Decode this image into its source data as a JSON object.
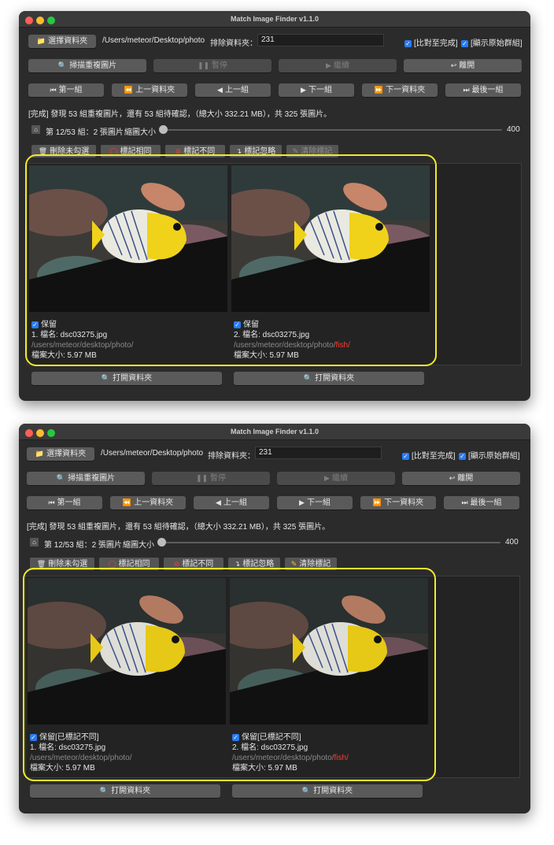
{
  "app": {
    "title": "Match Image Finder v1.1.0"
  },
  "toolbar": {
    "choose_folder": "選擇資料夾",
    "folder_path": "/Users/meteor/Desktop/photo",
    "exclude_label": "排除資料夾：",
    "exclude_value": "231",
    "compare_done": "[比對至完成]",
    "show_original": "[顯示原始群組]"
  },
  "actions": {
    "scan": "掃描重複圖片",
    "pause": "暫停",
    "resume": "繼續",
    "leave": "離開"
  },
  "nav": {
    "first": "第一組",
    "prev_folder": "上一資料夾",
    "prev": "上一組",
    "next": "下一組",
    "next_folder": "下一資料夾",
    "last": "最後一組"
  },
  "status": "[完成] 發現 53 組重複圖片，還有 53 組待確認，（總大小 332.21 MB），共 325 張圖片。",
  "group": {
    "info": "第 12/53 組：2 張圖片",
    "zoom_label": "縮圖大小",
    "zoom_value": "400",
    "zoom_fraction": 0.0
  },
  "marks": {
    "delete_unchecked": "刪除未勾選",
    "mark_same": "標記相同",
    "mark_diff": "標記不同",
    "mark_ignore": "標記忽略",
    "clear_marks": "清除標記"
  },
  "screens": [
    {
      "cards": [
        {
          "keep": "保留",
          "name": "1. 檔名: dsc03275.jpg",
          "path": "/users/meteor/desktop/photo/",
          "path_extra": "",
          "size": "檔案大小: 5.97 MB"
        },
        {
          "keep": "保留",
          "name": "2. 檔名: dsc03275.jpg",
          "path": "/users/meteor/desktop/photo/",
          "path_extra": "fish/",
          "size": "檔案大小: 5.97 MB"
        }
      ],
      "open_folder": "打開資料夾"
    },
    {
      "cards": [
        {
          "keep": "保留[已標記不同]",
          "name": "1. 檔名: dsc03275.jpg",
          "path": "/users/meteor/desktop/photo/",
          "path_extra": "",
          "size": "檔案大小: 5.97 MB"
        },
        {
          "keep": "保留[已標記不同]",
          "name": "2. 檔名: dsc03275.jpg",
          "path": "/users/meteor/desktop/photo/",
          "path_extra": "fish/",
          "size": "檔案大小: 5.97 MB"
        }
      ],
      "open_folder": "打開資料夾"
    }
  ],
  "colors": {
    "highlight": "#f2ea2a",
    "path_extra": "#ff3b30",
    "checkbox": "#2a7bf0"
  }
}
